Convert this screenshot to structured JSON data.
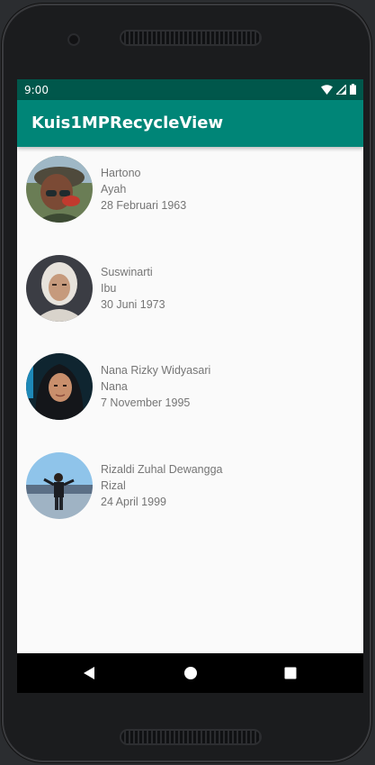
{
  "status": {
    "time": "9:00",
    "icons": [
      "wifi-icon",
      "signal-icon",
      "battery-icon"
    ]
  },
  "appbar": {
    "title": "Kuis1MPRecycleView",
    "color": "#008577"
  },
  "items": [
    {
      "name": "Hartono",
      "role": "Ayah",
      "date": "28 Februari 1963"
    },
    {
      "name": "Suswinarti",
      "role": "Ibu",
      "date": "30 Juni 1973"
    },
    {
      "name": "Nana Rizky Widyasari",
      "role": "Nana",
      "date": "7 November 1995"
    },
    {
      "name": "Rizaldi Zuhal Dewangga",
      "role": "Rizal",
      "date": "24 April 1999"
    }
  ],
  "navbar": {
    "buttons": [
      "back-icon",
      "home-icon",
      "recents-icon"
    ]
  }
}
